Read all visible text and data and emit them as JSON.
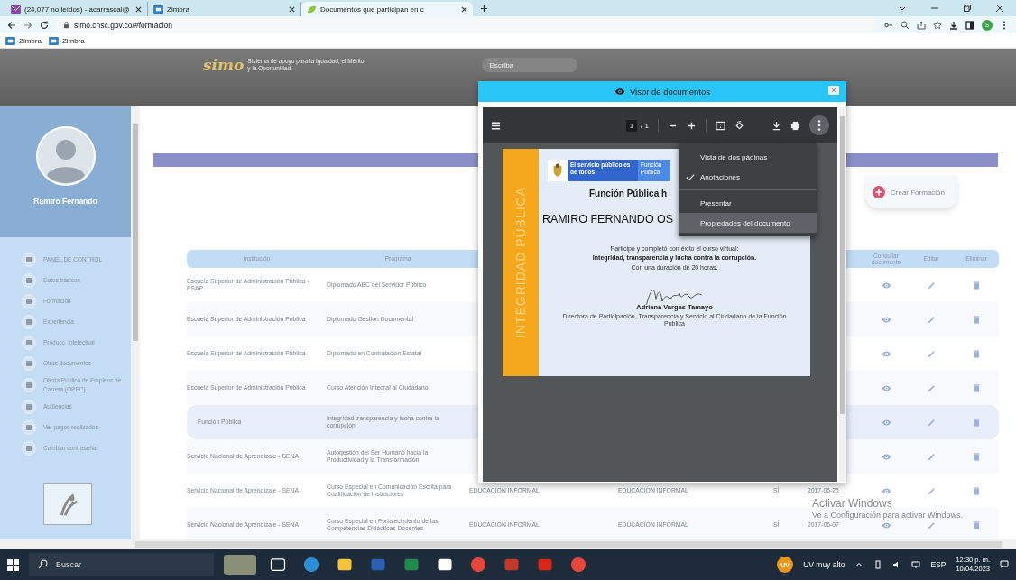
{
  "browser": {
    "tabs": [
      {
        "kind": "mail",
        "title": "(24,077 no leídos) - acarrascal@",
        "selected": false
      },
      {
        "kind": "zimbra",
        "title": "Zimbra",
        "selected": false
      },
      {
        "kind": "leaf",
        "title": "Documentos que participan en c",
        "selected": true
      }
    ],
    "address": "simo.cnsc.gov.co/#formacion",
    "profile": "S",
    "bookmarks": [
      "Zimbra",
      "Zimbra"
    ]
  },
  "site_header": {
    "logo": "simo",
    "tagline": "Sistema de apoyo para la Igualdad, el Mérito y la Oportunidad.",
    "search": {
      "placeholder": "Escriba"
    }
  },
  "sidebar": {
    "user_name": "Ramiro Fernando",
    "items": [
      {
        "label": "PANEL DE CONTROL"
      },
      {
        "label": "Datos básicos"
      },
      {
        "label": "Formación"
      },
      {
        "label": "Experiencia"
      },
      {
        "label": "Producc. intelectual"
      },
      {
        "label": "Otros documentos"
      },
      {
        "label": "Oferta Pública de Empleos de Carrera (OPEC)"
      },
      {
        "label": "Audiencias"
      },
      {
        "label": "Ver pagos realizados"
      },
      {
        "label": "Cambiar contraseña"
      }
    ]
  },
  "main": {
    "create_button": "Crear Formación",
    "table": {
      "columns": {
        "institution": "Institución",
        "program": "Programa",
        "consult": "Consultar documento",
        "edit": "Editar",
        "delete": "Eliminar"
      },
      "rows": [
        {
          "institution": "Escuela Superior de Administración Pública - ESAP",
          "program": "Diplomado ABC del Servidor Público",
          "selected": false
        },
        {
          "institution": "Escuela Superior de Administración Pública",
          "program": "Diplomado Gestión Documental",
          "selected": false
        },
        {
          "institution": "Escuela Superior de Administración Pública",
          "program": "Diplomado en Contratación Estatal",
          "selected": false
        },
        {
          "institution": "Escuela Superior de Administración Pública",
          "program": "Curso Atención Integral al Ciudadano",
          "selected": false
        },
        {
          "institution": "Función Pública",
          "program": "Integridad transparencia y lucha contra la corrupción",
          "selected": true
        },
        {
          "institution": "Servicio Nacional de Aprendizaje - SENA",
          "program": "Autogestión del Ser Humano hacia la Productividad y la Transformación",
          "selected": false
        },
        {
          "institution": "Servicio Nacional de Aprendizaje - SENA",
          "program": "Curso Especial en Comunicación Escrita para Cualificación de Instructores",
          "column_3": "EDUCACION INFORMAL",
          "column_4": "EDUCACION INFORMAL",
          "column_5": "SÍ",
          "column_6": "2017-06-25",
          "selected": false
        },
        {
          "institution": "Servicio Nacional de Aprendizaje - SENA",
          "program": "Curso Especial en Fortalecimiento de las Competencias Didácticas Docentes",
          "column_3": "EDUCACION INFORMAL",
          "column_4": "EDUCACION INFORMAL",
          "column_5": "SÍ",
          "column_6": "2017-06-07",
          "selected": false
        }
      ]
    }
  },
  "modal": {
    "title": "Visor de documentos",
    "viewer": {
      "page_input": "1",
      "page_total": "/ 1",
      "document": {
        "band": "INTEGRIDAD PÚBLICA",
        "logo_text": "El servicio público es de todos",
        "logo_entity": "Función Pública",
        "heading": "Función Pública h",
        "recipient": "RAMIRO FERNANDO OS",
        "lines": [
          "Participó y completó con éxito el curso virtual:"
        ],
        "course": "Integridad, transparencia y lucha contra la corrupción.",
        "duration": "Con una duración de 20 horas.",
        "signer": "Adriana Vargas Tamayo",
        "signer_role": "Directora de Participación, Transparencia y Servicio al Ciudadano de la Función Pública"
      },
      "menu": [
        {
          "label": "Vista de dos páginas",
          "checked": false,
          "selected": false
        },
        {
          "label": "Anotaciones",
          "checked": true,
          "selected": false
        },
        {
          "label": "Presentar",
          "checked": false,
          "selected": false
        },
        {
          "label": "Propiedades del documento",
          "checked": false,
          "selected": true
        }
      ]
    }
  },
  "watermark": {
    "title": "Activar Windows",
    "text": "Ve a Configuración para activar Windows."
  },
  "taskbar": {
    "search": {
      "placeholder": "Buscar"
    },
    "weather_badge": "UV",
    "weather": "UV muy alto",
    "language": "ESP",
    "time": "12:30 p. m.",
    "date": "10/04/2023"
  }
}
